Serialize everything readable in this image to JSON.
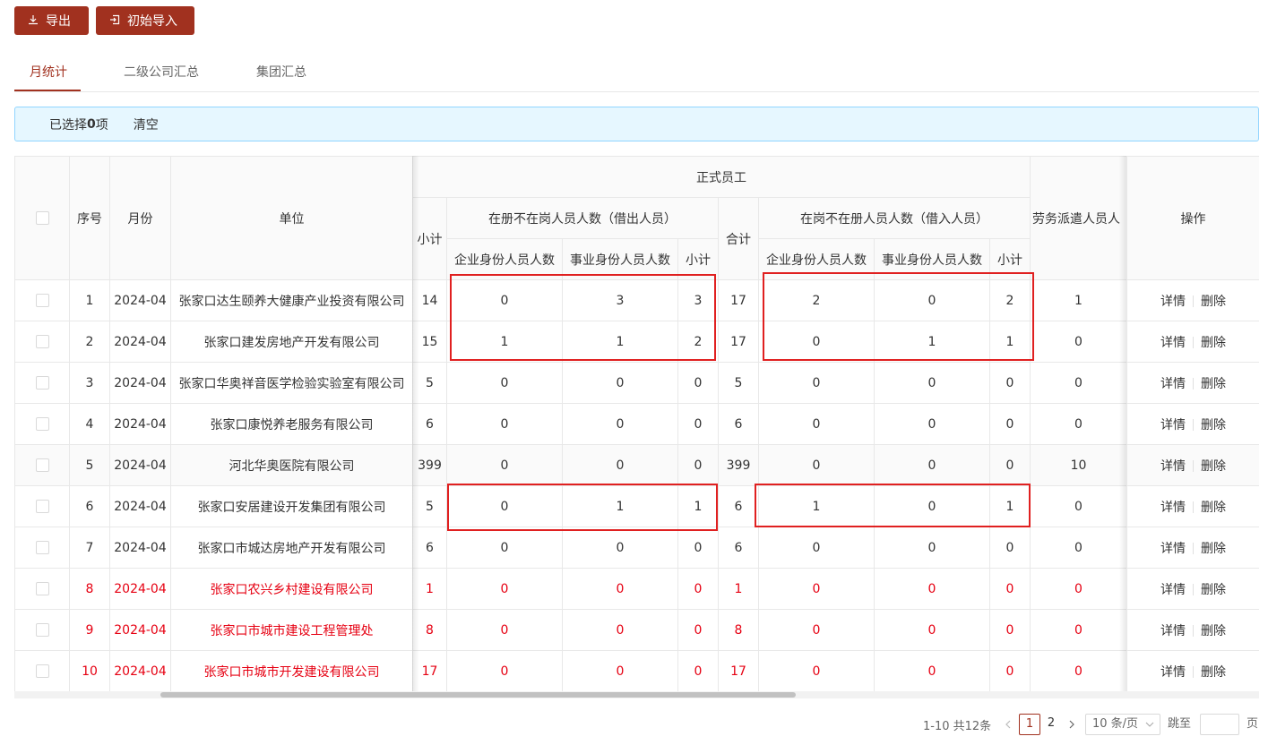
{
  "toolbar": {
    "export_label": "导出",
    "import_label": "初始导入",
    "export_icon": "download-icon",
    "import_icon": "import-icon"
  },
  "tabs": [
    {
      "label": "月统计",
      "active": true
    },
    {
      "label": "二级公司汇总",
      "active": false
    },
    {
      "label": "集团汇总",
      "active": false
    }
  ],
  "selection": {
    "prefix": "已选择 ",
    "count": "0",
    "suffix": "项",
    "clear_label": "清空"
  },
  "table": {
    "headers": {
      "index": "序号",
      "month": "月份",
      "unit": "单位",
      "formal_group": "正式员工",
      "subtotal": "小计",
      "lent_group": "在册不在岗人员人数（借出人员）",
      "enterprise_count": "企业身份人员人数",
      "institution_count": "事业身份人员人数",
      "total": "合计",
      "borrowed_group": "在岗不在册人员人数（借入人员）",
      "dispatch": "劳务派遣人员人",
      "action": "操作"
    },
    "action_labels": {
      "detail": "详情",
      "delete": "删除"
    },
    "rows": [
      {
        "no": "1",
        "month": "2024-04",
        "unit": "张家口达生颐养大健康产业投资有限公司",
        "c1": "14",
        "c2": "0",
        "c3": "3",
        "c4": "3",
        "c5": "17",
        "c6": "2",
        "c7": "0",
        "c8": "2",
        "c9": "1"
      },
      {
        "no": "2",
        "month": "2024-04",
        "unit": "张家口建发房地产开发有限公司",
        "c1": "15",
        "c2": "1",
        "c3": "1",
        "c4": "2",
        "c5": "17",
        "c6": "0",
        "c7": "1",
        "c8": "1",
        "c9": "0"
      },
      {
        "no": "3",
        "month": "2024-04",
        "unit": "张家口华奥祥音医学检验实验室有限公司",
        "c1": "5",
        "c2": "0",
        "c3": "0",
        "c4": "0",
        "c5": "5",
        "c6": "0",
        "c7": "0",
        "c8": "0",
        "c9": "0"
      },
      {
        "no": "4",
        "month": "2024-04",
        "unit": "张家口康悦养老服务有限公司",
        "c1": "6",
        "c2": "0",
        "c3": "0",
        "c4": "0",
        "c5": "6",
        "c6": "0",
        "c7": "0",
        "c8": "0",
        "c9": "0"
      },
      {
        "no": "5",
        "month": "2024-04",
        "unit": "河北华奥医院有限公司",
        "c1": "399",
        "c2": "0",
        "c3": "0",
        "c4": "0",
        "c5": "399",
        "c6": "0",
        "c7": "0",
        "c8": "0",
        "c9": "10"
      },
      {
        "no": "6",
        "month": "2024-04",
        "unit": "张家口安居建设开发集团有限公司",
        "c1": "5",
        "c2": "0",
        "c3": "1",
        "c4": "1",
        "c5": "6",
        "c6": "1",
        "c7": "0",
        "c8": "1",
        "c9": "0"
      },
      {
        "no": "7",
        "month": "2024-04",
        "unit": "张家口市城达房地产开发有限公司",
        "c1": "6",
        "c2": "0",
        "c3": "0",
        "c4": "0",
        "c5": "6",
        "c6": "0",
        "c7": "0",
        "c8": "0",
        "c9": "0"
      },
      {
        "no": "8",
        "month": "2024-04",
        "unit": "张家口农兴乡村建设有限公司",
        "c1": "1",
        "c2": "0",
        "c3": "0",
        "c4": "0",
        "c5": "1",
        "c6": "0",
        "c7": "0",
        "c8": "0",
        "c9": "0"
      },
      {
        "no": "9",
        "month": "2024-04",
        "unit": "张家口市城市建设工程管理处",
        "c1": "8",
        "c2": "0",
        "c3": "0",
        "c4": "0",
        "c5": "8",
        "c6": "0",
        "c7": "0",
        "c8": "0",
        "c9": "0"
      },
      {
        "no": "10",
        "month": "2024-04",
        "unit": "张家口市城市开发建设有限公司",
        "c1": "17",
        "c2": "0",
        "c3": "0",
        "c4": "0",
        "c5": "17",
        "c6": "0",
        "c7": "0",
        "c8": "0",
        "c9": "0"
      }
    ]
  },
  "pagination": {
    "total_text": "1-10 共12条",
    "pages": [
      "1",
      "2"
    ],
    "current": "1",
    "page_size": "10 条/页",
    "jump_label": "跳至",
    "jump_suffix": "页"
  },
  "colors": {
    "brand": "#a1311f",
    "highlight_text": "#e60012",
    "annotation_box": "#e02020"
  }
}
